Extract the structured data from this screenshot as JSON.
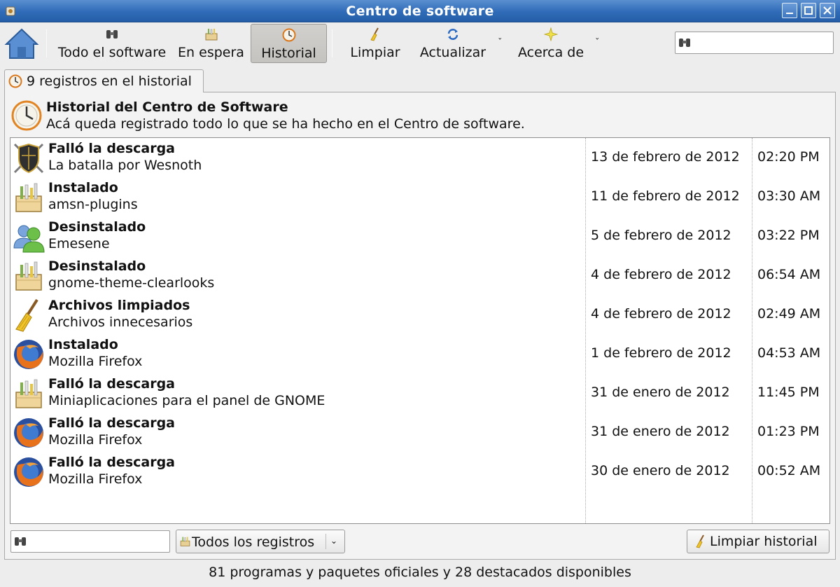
{
  "window": {
    "title": "Centro de software"
  },
  "toolbar": {
    "home_icon": "home-icon",
    "items": [
      {
        "label": "Todo el software",
        "icon": "binoculars-icon"
      },
      {
        "label": "En espera",
        "icon": "package-icon"
      },
      {
        "label": "Historial",
        "icon": "clock-icon",
        "active": true
      },
      {
        "label": "Limpiar",
        "icon": "broom-icon"
      },
      {
        "label": "Actualizar",
        "icon": "refresh-icon"
      },
      {
        "label": "Acerca de",
        "icon": "star-icon"
      }
    ],
    "search_placeholder": ""
  },
  "tab": {
    "label": "9 registros en el historial"
  },
  "header": {
    "title": "Historial del Centro de Software",
    "subtitle": "Acá queda registrado todo lo que se ha hecho en el Centro de software."
  },
  "history": [
    {
      "status": "Falló la descarga",
      "name": "La batalla por Wesnoth",
      "date": "13 de febrero de 2012",
      "time": "02:20 PM",
      "icon": "shield-icon"
    },
    {
      "status": "Instalado",
      "name": "amsn-plugins",
      "date": "11 de febrero de 2012",
      "time": "03:30 AM",
      "icon": "package-icon"
    },
    {
      "status": "Desinstalado",
      "name": "Emesene",
      "date": "5 de febrero de 2012",
      "time": "03:22 PM",
      "icon": "users-icon"
    },
    {
      "status": "Desinstalado",
      "name": "gnome-theme-clearlooks",
      "date": "4 de febrero de 2012",
      "time": "06:54 AM",
      "icon": "package-icon"
    },
    {
      "status": "Archivos limpiados",
      "name": "Archivos innecesarios",
      "date": "4 de febrero de 2012",
      "time": "02:49 AM",
      "icon": "broom-icon"
    },
    {
      "status": "Instalado",
      "name": "Mozilla Firefox",
      "date": "1 de febrero de 2012",
      "time": "04:53 AM",
      "icon": "firefox-icon"
    },
    {
      "status": "Falló la descarga",
      "name": "Miniaplicaciones para el panel de GNOME",
      "date": "31 de enero de 2012",
      "time": "11:45 PM",
      "icon": "package-icon"
    },
    {
      "status": "Falló la descarga",
      "name": "Mozilla Firefox",
      "date": "31 de enero de 2012",
      "time": "01:23 PM",
      "icon": "firefox-icon"
    },
    {
      "status": "Falló la descarga",
      "name": "Mozilla Firefox",
      "date": "30 de enero de 2012",
      "time": "00:52 AM",
      "icon": "firefox-icon"
    }
  ],
  "filter": {
    "search_value": "",
    "combo_selected": "Todos los registros",
    "clear_button": "Limpiar historial"
  },
  "status": {
    "text": "81 programas y paquetes oficiales y 28 destacados disponibles"
  },
  "colors": {
    "titlebar": "#2f6bb8",
    "window_bg": "#ededed"
  }
}
